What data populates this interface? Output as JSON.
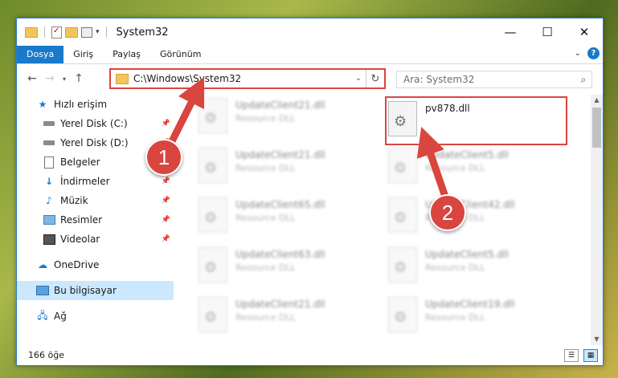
{
  "window": {
    "title": "System32",
    "controls": {
      "minimize": "—",
      "maximize": "☐",
      "close": "✕"
    }
  },
  "ribbon": {
    "tabs": [
      "Dosya",
      "Giriş",
      "Paylaş",
      "Görünüm"
    ],
    "active_tab": "Dosya",
    "help": "?"
  },
  "navbar": {
    "back": "←",
    "forward": "→",
    "recent": "▾",
    "up": "↑",
    "address": "C:\\Windows\\System32",
    "refresh": "↻",
    "search_placeholder": "Ara: System32"
  },
  "sidebar": {
    "items": [
      {
        "label": "Hızlı erişim",
        "icon": "star-icon",
        "pinned": false
      },
      {
        "label": "Yerel Disk (C:)",
        "icon": "drive-icon",
        "pinned": true
      },
      {
        "label": "Yerel Disk (D:)",
        "icon": "drive-icon",
        "pinned": true
      },
      {
        "label": "Belgeler",
        "icon": "document-icon",
        "pinned": true
      },
      {
        "label": "İndirmeler",
        "icon": "download-icon",
        "pinned": true
      },
      {
        "label": "Müzik",
        "icon": "music-icon",
        "pinned": true
      },
      {
        "label": "Resimler",
        "icon": "picture-icon",
        "pinned": true
      },
      {
        "label": "Videolar",
        "icon": "video-icon",
        "pinned": true
      },
      {
        "label": "OneDrive",
        "icon": "cloud-icon",
        "pinned": false
      },
      {
        "label": "Bu bilgisayar",
        "icon": "computer-icon",
        "pinned": false,
        "selected": true
      },
      {
        "label": "Ağ",
        "icon": "network-icon",
        "pinned": false
      }
    ]
  },
  "files": {
    "column1": [
      {
        "name": "UpdateClient21.dll",
        "type": "Resource DLL"
      },
      {
        "name": "UpdateClient21.dll",
        "type": "Resource DLL"
      },
      {
        "name": "UpdateClient65.dll",
        "type": "Resource DLL"
      },
      {
        "name": "UpdateClient63.dll",
        "type": "Resource DLL"
      },
      {
        "name": "UpdateClient21.dll",
        "type": "Resource DLL"
      }
    ],
    "column2": [
      {
        "name": "pv878.dll",
        "type": ""
      },
      {
        "name": "UpdateClient5.dll",
        "type": "Resource DLL"
      },
      {
        "name": "UpdateClient42.dll",
        "type": "Resource DLL"
      },
      {
        "name": "UpdateClient5.dll",
        "type": "Resource DLL"
      },
      {
        "name": "UpdateClient19.dll",
        "type": "Resource DLL"
      }
    ]
  },
  "annotations": {
    "step1": "1",
    "step2": "2",
    "highlight_color": "#d9453f"
  },
  "status": {
    "item_count": "166 öğe"
  }
}
